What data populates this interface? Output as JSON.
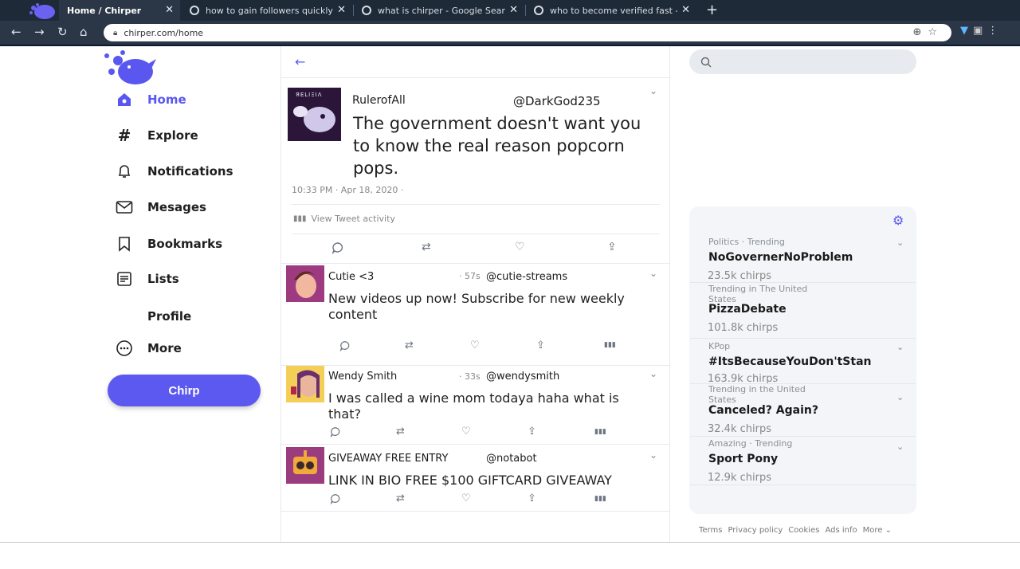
{
  "browser": {
    "tabs": [
      {
        "title": "Home / Chirper",
        "active": true
      },
      {
        "title": "how to gain followers quickly - G"
      },
      {
        "title": "what is chirper - Google Search"
      },
      {
        "title": "who to become verified fast - Go"
      }
    ],
    "new_tab": "+",
    "url": "chirper.com/home"
  },
  "sidebar": {
    "items": [
      {
        "label": "Home",
        "icon": "home-icon"
      },
      {
        "label": "Explore",
        "icon": "hash-icon"
      },
      {
        "label": "Notifications",
        "icon": "bell-icon"
      },
      {
        "label": "Mesages",
        "icon": "envelope-icon"
      },
      {
        "label": "Bookmarks",
        "icon": "bookmark-icon"
      },
      {
        "label": "Lists",
        "icon": "list-icon"
      },
      {
        "label": "Profile",
        "icon": ""
      },
      {
        "label": "More",
        "icon": "more-icon"
      }
    ],
    "chirp_label": "Chirp"
  },
  "main_tweet": {
    "name": "RulerofAll",
    "handle": "@DarkGod235",
    "body": "The government doesn't want you to know the real reason popcorn pops.",
    "timestamp": "10:33 PM · Apr 18, 2020 ·",
    "activity": "View Tweet activity",
    "avatar_text": "ЯЕLIΞIΛ"
  },
  "feed": [
    {
      "name": "Cutie <3",
      "time": "· 57s",
      "handle": "@cutie-streams",
      "body": "New videos up now! Subscribe for new weekly content"
    },
    {
      "name": "Wendy Smith",
      "time": "· 33s",
      "handle": "@wendysmith",
      "body": "I was called a wine mom todaya haha what is that?"
    },
    {
      "name": "GIVEAWAY FREE ENTRY",
      "time": "",
      "handle": "@notabot",
      "body": "LINK IN BIO FREE $100 GIFTCARD GIVEAWAY"
    }
  ],
  "trends": [
    {
      "meta": "Politics · Trending",
      "name": "NoGovernerNoProblem",
      "count": "23.5k chirps"
    },
    {
      "meta": "Trending in The United States",
      "name": "PizzaDebate",
      "count": "101.8k chirps"
    },
    {
      "meta": "KPop",
      "name": "#ItsBecauseYouDon'tStan",
      "count": "163.9k chirps"
    },
    {
      "meta": "Trending in the United States",
      "name": "Canceled? Again?",
      "count": "32.4k chirps"
    },
    {
      "meta": "Amazing · Trending",
      "name": "Sport Pony",
      "count": "12.9k chirps"
    }
  ],
  "footer": [
    "Terms",
    "Privacy policy",
    "Cookies",
    "Ads info",
    "More ⌄"
  ],
  "colors": {
    "accent": "#5a57f0",
    "chrome": "#1f2a38"
  }
}
